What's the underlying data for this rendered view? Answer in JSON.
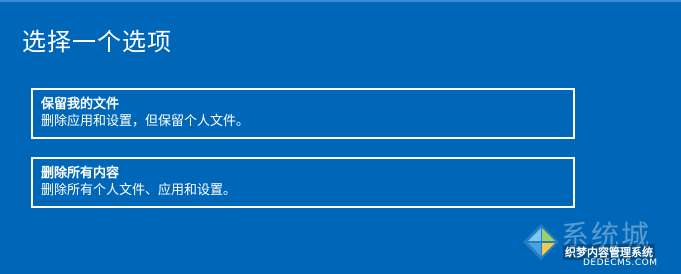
{
  "dialog": {
    "title": "选择一个选项",
    "options": [
      {
        "title": "保留我的文件",
        "description": "删除应用和设置，但保留个人文件。"
      },
      {
        "title": "删除所有内容",
        "description": "删除所有个人文件、应用和设置。"
      }
    ]
  },
  "watermark": {
    "logo_text": "系统城",
    "tag": "织梦内容管理系统",
    "url": "DEDECMS.COM",
    "icon": "windows-logo-icon"
  },
  "colors": {
    "background": "#0067b8",
    "border": "#ffffff"
  }
}
